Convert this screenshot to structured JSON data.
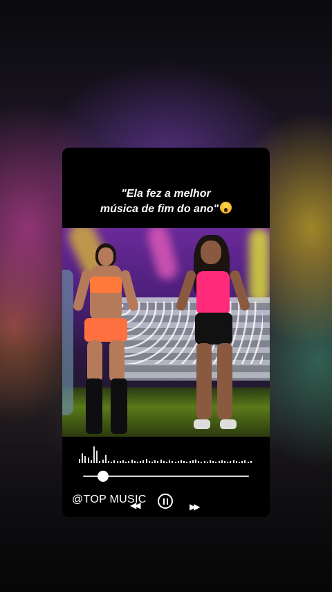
{
  "post": {
    "caption_line1": "\"Ela fez a melhor",
    "caption_line2": "música de fim do ano\"",
    "caption_emoji": "face-screaming-in-fear-icon"
  },
  "player": {
    "brand": "@TOP MUSIC",
    "progress": 0.12,
    "icons": {
      "previous": "rewind-icon",
      "play_pause": "pause-icon",
      "next": "fast-forward-icon"
    }
  },
  "colors": {
    "card_background": "#000000",
    "text": "#ffffff",
    "stage_purple": "#6a2a9a",
    "outfit_pink": "#ff2a7a",
    "outfit_orange": "#ff7a3a"
  }
}
